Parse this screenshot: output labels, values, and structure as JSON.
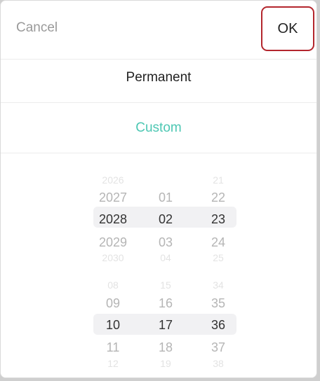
{
  "header": {
    "cancel_label": "Cancel",
    "ok_label": "OK"
  },
  "options": {
    "permanent_label": "Permanent",
    "custom_label": "Custom"
  },
  "date_picker": {
    "columns": [
      "year",
      "month",
      "day"
    ],
    "rows": [
      {
        "year": "2026",
        "month": "",
        "day": "21"
      },
      {
        "year": "2027",
        "month": "01",
        "day": "22"
      },
      {
        "year": "2028",
        "month": "02",
        "day": "23"
      },
      {
        "year": "2029",
        "month": "03",
        "day": "24"
      },
      {
        "year": "2030",
        "month": "04",
        "day": "25"
      }
    ],
    "selected": {
      "year": "2028",
      "month": "02",
      "day": "23"
    }
  },
  "time_picker": {
    "columns": [
      "hour",
      "minute",
      "second"
    ],
    "rows": [
      {
        "hour": "08",
        "minute": "15",
        "second": "34"
      },
      {
        "hour": "09",
        "minute": "16",
        "second": "35"
      },
      {
        "hour": "10",
        "minute": "17",
        "second": "36"
      },
      {
        "hour": "11",
        "minute": "18",
        "second": "37"
      },
      {
        "hour": "12",
        "minute": "19",
        "second": "38"
      }
    ],
    "selected": {
      "hour": "10",
      "minute": "17",
      "second": "36"
    }
  },
  "colors": {
    "accent": "#4dc7b3",
    "highlight_border": "#b3262d"
  }
}
